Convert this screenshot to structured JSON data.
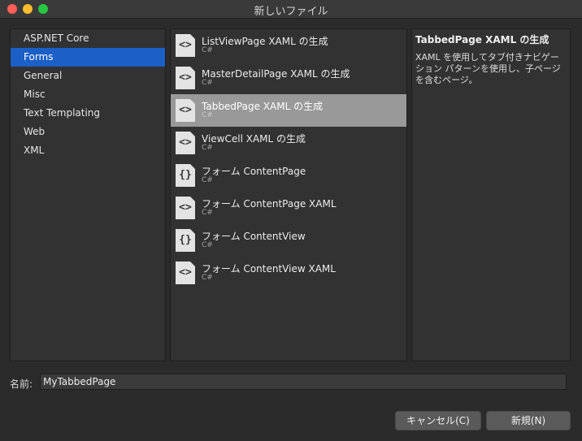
{
  "window": {
    "title": "新しいファイル"
  },
  "categories": [
    {
      "label": "ASP.NET Core",
      "selected": false
    },
    {
      "label": "Forms",
      "selected": true
    },
    {
      "label": "General",
      "selected": false
    },
    {
      "label": "Misc",
      "selected": false
    },
    {
      "label": "Text Templating",
      "selected": false
    },
    {
      "label": "Web",
      "selected": false
    },
    {
      "label": "XML",
      "selected": false
    }
  ],
  "templates": [
    {
      "name": "ListViewPage XAML の生成",
      "language": "C#",
      "icon": "xaml-code-icon",
      "glyph": "<>"
    },
    {
      "name": "MasterDetailPage XAML の生成",
      "language": "C#",
      "icon": "xaml-code-icon",
      "glyph": "<>"
    },
    {
      "name": "TabbedPage XAML の生成",
      "language": "C#",
      "icon": "xaml-code-icon",
      "glyph": "<>",
      "selected": true
    },
    {
      "name": "ViewCell XAML の生成",
      "language": "C#",
      "icon": "xaml-code-icon",
      "glyph": "<>"
    },
    {
      "name": "フォーム ContentPage",
      "language": "C#",
      "icon": "csharp-class-icon",
      "glyph": "{}"
    },
    {
      "name": "フォーム ContentPage XAML",
      "language": "C#",
      "icon": "xaml-code-icon",
      "glyph": "<>"
    },
    {
      "name": "フォーム ContentView",
      "language": "C#",
      "icon": "csharp-class-icon",
      "glyph": "{}"
    },
    {
      "name": "フォーム ContentView XAML",
      "language": "C#",
      "icon": "xaml-code-icon",
      "glyph": "<>"
    }
  ],
  "description": {
    "title": "TabbedPage XAML の生成",
    "body": "XAML を使用してタブ付きナビゲーション パターンを使用し、子ページを含むページ。"
  },
  "name_field": {
    "label": "名前:",
    "value": "MyTabbedPage"
  },
  "buttons": {
    "cancel": "キャンセル(C)",
    "new": "新規(N)"
  },
  "colors": {
    "selection_blue": "#1c5fc6",
    "selected_template": "#999999"
  }
}
